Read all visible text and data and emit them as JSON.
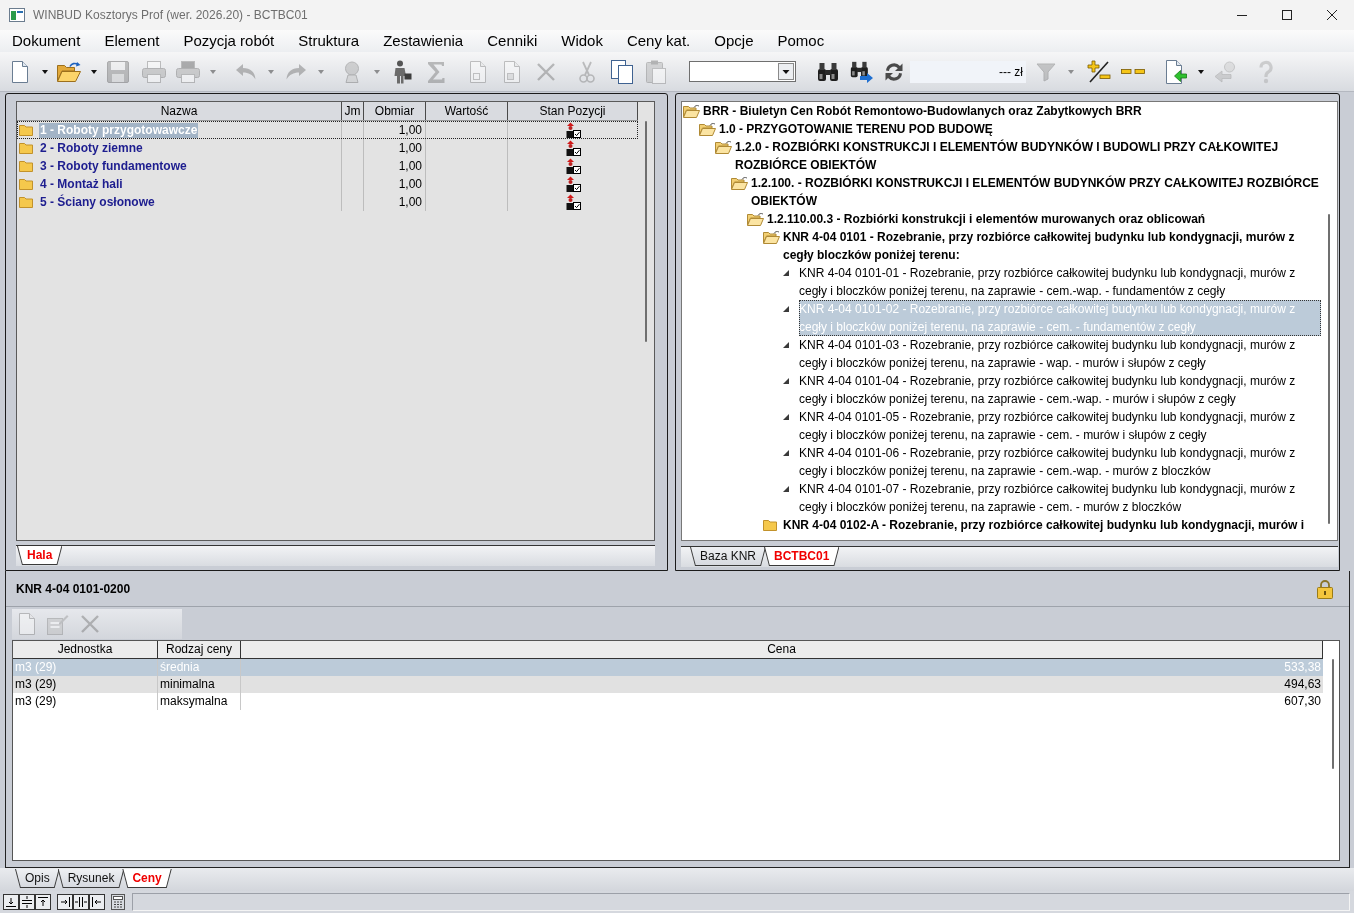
{
  "window": {
    "title": "WINBUD Kosztorys Prof (wer. 2026.20) - BCTBC01"
  },
  "menu": [
    "Dokument",
    "Element",
    "Pozycja robót",
    "Struktura",
    "Zestawienia",
    "Cenniki",
    "Widok",
    "Ceny kat.",
    "Opcje",
    "Pomoc"
  ],
  "toolbar": [
    {
      "kind": "new-document",
      "disabled": false
    },
    {
      "kind": "caret",
      "disabled": false
    },
    {
      "kind": "open-folder",
      "disabled": false
    },
    {
      "kind": "caret",
      "disabled": false
    },
    {
      "kind": "save",
      "disabled": true
    },
    {
      "kind": "print",
      "disabled": true
    },
    {
      "kind": "print-pdf",
      "disabled": true
    },
    {
      "kind": "caret",
      "disabled": true
    },
    {
      "kind": "undo",
      "disabled": true
    },
    {
      "kind": "caret",
      "disabled": true
    },
    {
      "kind": "redo",
      "disabled": true
    },
    {
      "kind": "caret",
      "disabled": true
    },
    {
      "kind": "stamp",
      "disabled": true
    },
    {
      "kind": "caret",
      "disabled": true
    },
    {
      "kind": "worker",
      "disabled": false
    },
    {
      "kind": "sum",
      "disabled": true
    },
    {
      "kind": "doc-e",
      "disabled": true
    },
    {
      "kind": "doc-p",
      "disabled": true
    },
    {
      "kind": "delete",
      "disabled": true
    },
    {
      "kind": "cut",
      "disabled": true
    },
    {
      "kind": "copy",
      "disabled": false
    },
    {
      "kind": "paste",
      "disabled": true
    },
    {
      "kind": "combo",
      "disabled": false
    },
    {
      "kind": "find",
      "disabled": false
    },
    {
      "kind": "find-next",
      "disabled": false
    },
    {
      "kind": "refresh",
      "disabled": false
    },
    {
      "kind": "price-field",
      "value": "--- zł",
      "disabled": false
    },
    {
      "kind": "filter",
      "disabled": true
    },
    {
      "kind": "caret",
      "disabled": true
    },
    {
      "kind": "plus-minus",
      "disabled": false
    },
    {
      "kind": "minus-minus",
      "disabled": false
    },
    {
      "kind": "import",
      "disabled": false
    },
    {
      "kind": "caret",
      "disabled": false
    },
    {
      "kind": "stamp-back",
      "disabled": true
    },
    {
      "kind": "help",
      "disabled": true
    }
  ],
  "left_panel": {
    "columns": [
      "Nazwa",
      "Jm",
      "Obmiar",
      "Wartość",
      "Stan Pozycji"
    ],
    "rows": [
      {
        "name": "1 - Roboty przygotowawcze",
        "obmiar": "1,00",
        "selected": true
      },
      {
        "name": "2 - Roboty ziemne",
        "obmiar": "1,00",
        "selected": false
      },
      {
        "name": "3 - Roboty fundamentowe",
        "obmiar": "1,00",
        "selected": false
      },
      {
        "name": "4 - Montaż hali",
        "obmiar": "1,00",
        "selected": false
      },
      {
        "name": "5 - Ściany osłonowe",
        "obmiar": "1,00",
        "selected": false
      }
    ],
    "tabs": [
      {
        "label": "Hala",
        "selected": true
      }
    ]
  },
  "right_panel": {
    "tree": [
      {
        "label": "BRR - Biuletyn Cen Robót Remontowo-Budowlanych oraz Zabytkowych BRR",
        "kind": "group",
        "expanded": true,
        "selected": false,
        "children": [
          {
            "label": "1.0 - PRZYGOTOWANIE TERENU POD BUDOWĘ",
            "kind": "group",
            "expanded": true,
            "selected": false,
            "children": [
              {
                "label": "1.2.0 - ROZBIÓRKI KONSTRUKCJI I ELEMENTÓW BUDYNKÓW I BUDOWLI PRZY CAŁKOWITEJ ROZBIÓRCE OBIEKTÓW",
                "kind": "group",
                "expanded": true,
                "selected": false,
                "children": [
                  {
                    "label": "1.2.100. - ROZBIÓRKI KONSTRUKCJI I ELEMENTÓW BUDYNKÓW PRZY CAŁKOWITEJ ROZBIÓRCE OBIEKTÓW",
                    "kind": "group",
                    "expanded": true,
                    "selected": false,
                    "children": [
                      {
                        "label": "1.2.110.00.3 - Rozbiórki konstrukcji i elementów murowanych oraz oblicowań",
                        "kind": "group",
                        "expanded": true,
                        "selected": false,
                        "children": [
                          {
                            "label": "KNR 4-04 0101 - Rozebranie, przy rozbiórce całkowitej budynku lub kondygnacji, murów z cegły bloczków poniżej terenu:",
                            "kind": "group",
                            "expanded": true,
                            "selected": false,
                            "children": [
                              {
                                "label": "KNR 4-04 0101-01 - Rozebranie, przy rozbiórce całkowitej budynku lub kondygnacji, murów z cegły i bloczków poniżej terenu, na zaprawie - cem.-wap. - fundamentów z cegły",
                                "kind": "item",
                                "selected": false
                              },
                              {
                                "label": "KNR 4-04 0101-02 - Rozebranie, przy rozbiórce całkowitej budynku lub kondygnacji, murów z cegły i bloczków poniżej terenu, na zaprawie - cem. - fundamentów z cegły",
                                "kind": "item",
                                "selected": true
                              },
                              {
                                "label": "KNR 4-04 0101-03 - Rozebranie, przy rozbiórce całkowitej budynku lub kondygnacji, murów z cegły i bloczków poniżej terenu, na zaprawie - wap. - murów i słupów z cegły",
                                "kind": "item",
                                "selected": false
                              },
                              {
                                "label": "KNR 4-04 0101-04 - Rozebranie, przy rozbiórce całkowitej budynku lub kondygnacji, murów z cegły i bloczków poniżej terenu, na zaprawie - cem.-wap. - murów i słupów z cegły",
                                "kind": "item",
                                "selected": false
                              },
                              {
                                "label": "KNR 4-04 0101-05 - Rozebranie, przy rozbiórce całkowitej budynku lub kondygnacji, murów z cegły i bloczków poniżej terenu, na zaprawie - cem. - murów i słupów z cegły",
                                "kind": "item",
                                "selected": false
                              },
                              {
                                "label": "KNR 4-04 0101-06 - Rozebranie, przy rozbiórce całkowitej budynku lub kondygnacji, murów z cegły i bloczków poniżej terenu, na zaprawie - cem.-wap. - murów z bloczków",
                                "kind": "item",
                                "selected": false
                              },
                              {
                                "label": "KNR 4-04 0101-07 - Rozebranie, przy rozbiórce całkowitej budynku lub kondygnacji, murów z cegły i bloczków poniżej terenu, na zaprawie - cem. - murów z bloczków",
                                "kind": "item",
                                "selected": false
                              }
                            ]
                          },
                          {
                            "label": "KNR 4-04 0102-A - Rozebranie, przy rozbiórce całkowitej budynku lub kondygnacji, murów i",
                            "kind": "group",
                            "expanded": false,
                            "selected": false
                          }
                        ]
                      }
                    ]
                  }
                ]
              }
            ]
          }
        ]
      }
    ],
    "tabs": [
      {
        "label": "Baza KNR",
        "selected": false
      },
      {
        "label": "BCTBC01",
        "selected": true
      }
    ]
  },
  "detail": {
    "title": "KNR 4-04 0101-0200",
    "toolbar": [
      {
        "kind": "new-document",
        "disabled": true
      },
      {
        "kind": "edit",
        "disabled": true
      },
      {
        "kind": "delete",
        "disabled": true
      }
    ],
    "columns": [
      "Jednostka",
      "Rodzaj ceny",
      "Cena"
    ],
    "rows": [
      {
        "unit": "m3 (29)",
        "type": "średnia",
        "price": "533,38",
        "selected": true,
        "highlighted": false
      },
      {
        "unit": "m3 (29)",
        "type": "minimalna",
        "price": "494,63",
        "selected": false,
        "highlighted": true
      },
      {
        "unit": "m3 (29)",
        "type": "maksymalna",
        "price": "607,30",
        "selected": false,
        "highlighted": false
      }
    ],
    "tabs": [
      {
        "label": "Opis",
        "selected": false
      },
      {
        "label": "Rysunek",
        "selected": false
      },
      {
        "label": "Ceny",
        "selected": true
      }
    ]
  }
}
